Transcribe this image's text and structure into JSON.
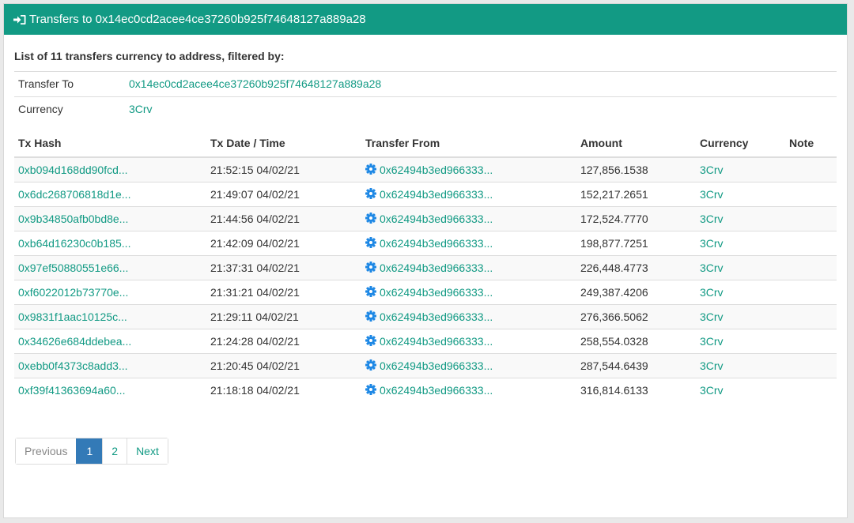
{
  "header": {
    "title": "Transfers to 0x14ec0cd2acee4ce37260b925f74648127a889a28"
  },
  "summary": "List of 11 transfers currency to address, filtered by:",
  "filters": [
    {
      "label": "Transfer To",
      "value": "0x14ec0cd2acee4ce37260b925f74648127a889a28"
    },
    {
      "label": "Currency",
      "value": "3Crv"
    }
  ],
  "table": {
    "headers": [
      "Tx Hash",
      "Tx Date / Time",
      "Transfer From",
      "Amount",
      "Currency",
      "Note"
    ],
    "rows": [
      {
        "hash": "0xb094d168dd90fcd...",
        "datetime": "21:52:15 04/02/21",
        "from": "0x62494b3ed966333...",
        "amount": "127,856.1538",
        "currency": "3Crv",
        "note": ""
      },
      {
        "hash": "0x6dc268706818d1e...",
        "datetime": "21:49:07 04/02/21",
        "from": "0x62494b3ed966333...",
        "amount": "152,217.2651",
        "currency": "3Crv",
        "note": ""
      },
      {
        "hash": "0x9b34850afb0bd8e...",
        "datetime": "21:44:56 04/02/21",
        "from": "0x62494b3ed966333...",
        "amount": "172,524.7770",
        "currency": "3Crv",
        "note": ""
      },
      {
        "hash": "0xb64d16230c0b185...",
        "datetime": "21:42:09 04/02/21",
        "from": "0x62494b3ed966333...",
        "amount": "198,877.7251",
        "currency": "3Crv",
        "note": ""
      },
      {
        "hash": "0x97ef50880551e66...",
        "datetime": "21:37:31 04/02/21",
        "from": "0x62494b3ed966333...",
        "amount": "226,448.4773",
        "currency": "3Crv",
        "note": ""
      },
      {
        "hash": "0xf6022012b73770e...",
        "datetime": "21:31:21 04/02/21",
        "from": "0x62494b3ed966333...",
        "amount": "249,387.4206",
        "currency": "3Crv",
        "note": ""
      },
      {
        "hash": "0x9831f1aac10125c...",
        "datetime": "21:29:11 04/02/21",
        "from": "0x62494b3ed966333...",
        "amount": "276,366.5062",
        "currency": "3Crv",
        "note": ""
      },
      {
        "hash": "0x34626e684ddebea...",
        "datetime": "21:24:28 04/02/21",
        "from": "0x62494b3ed966333...",
        "amount": "258,554.0328",
        "currency": "3Crv",
        "note": ""
      },
      {
        "hash": "0xebb0f4373c8add3...",
        "datetime": "21:20:45 04/02/21",
        "from": "0x62494b3ed966333...",
        "amount": "287,544.6439",
        "currency": "3Crv",
        "note": ""
      },
      {
        "hash": "0xf39f41363694a60...",
        "datetime": "21:18:18 04/02/21",
        "from": "0x62494b3ed966333...",
        "amount": "316,814.6133",
        "currency": "3Crv",
        "note": ""
      }
    ]
  },
  "pagination": {
    "previous": "Previous",
    "pages": [
      "1",
      "2"
    ],
    "active_page": "1",
    "next": "Next"
  },
  "icons": {
    "header": "sign-in-icon",
    "from_address": "gear-icon"
  },
  "colors": {
    "accent": "#129a84",
    "active_page": "#337ab7",
    "gear": "#1e88e5"
  }
}
